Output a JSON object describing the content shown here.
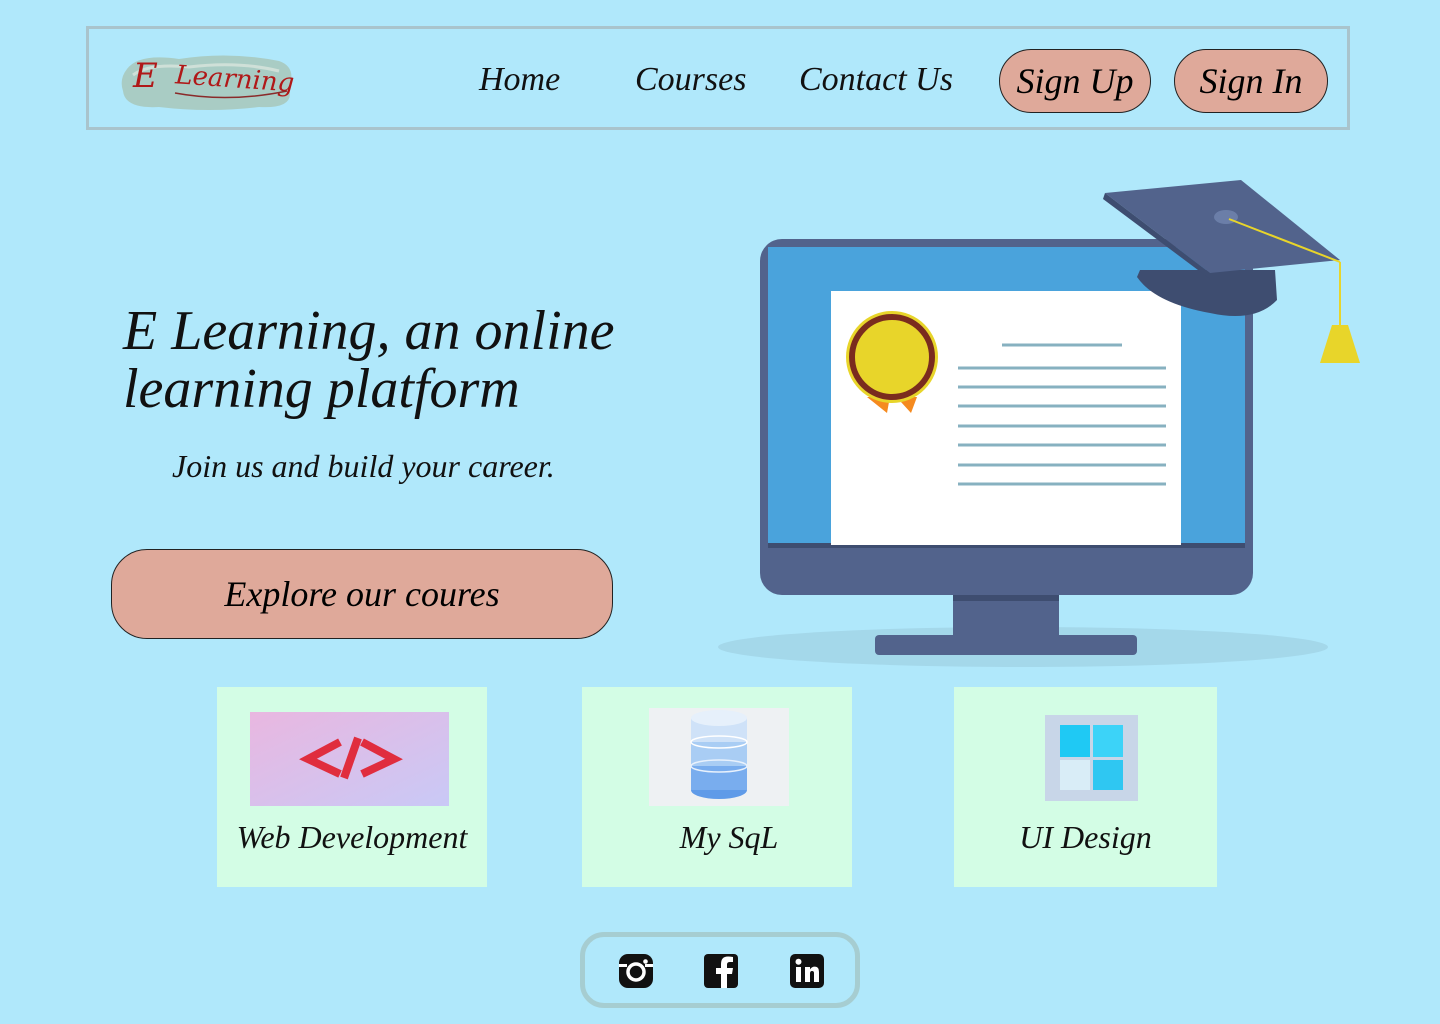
{
  "brand": {
    "logo_text_e": "E",
    "logo_text_learning": "Learning"
  },
  "nav": {
    "home": "Home",
    "courses": "Courses",
    "contact": "Contact Us",
    "sign_up": "Sign Up",
    "sign_in": "Sign In"
  },
  "hero": {
    "title_line1": "E Learning, an online",
    "title_line2": "learning platform",
    "subtitle": "Join us and build your career.",
    "cta": "Explore our coures",
    "illustration_icon": "computer-certificate-graduation-cap"
  },
  "courses": [
    {
      "label": "Web Development",
      "icon": "code-brackets-icon"
    },
    {
      "label": "My SqL",
      "icon": "database-icon"
    },
    {
      "label": "UI Design",
      "icon": "windows-tiles-icon"
    }
  ],
  "social": [
    {
      "icon": "instagram-icon"
    },
    {
      "icon": "facebook-icon"
    },
    {
      "icon": "linkedin-icon"
    }
  ],
  "colors": {
    "background": "#b0e8fb",
    "button": "#dfa99a",
    "card": "#d3fde5",
    "monitor": "#52638c"
  }
}
